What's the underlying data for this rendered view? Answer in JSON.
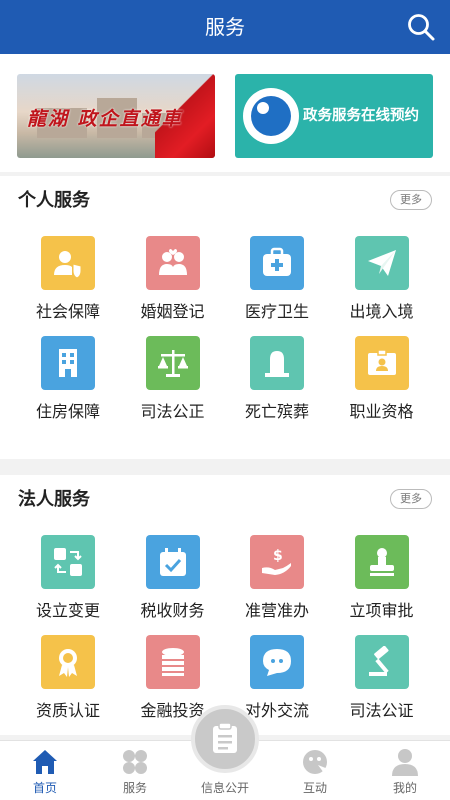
{
  "header": {
    "title": "服务"
  },
  "banners": {
    "left_text": "龍湖 政企直通車",
    "right_text": "政务服务在线预约"
  },
  "personal": {
    "title": "个人服务",
    "more": "更多",
    "items": [
      {
        "label": "社会保障",
        "icon": "user-shield-icon",
        "color": "#f5c24a"
      },
      {
        "label": "婚姻登记",
        "icon": "couple-icon",
        "color": "#e88989"
      },
      {
        "label": "医疗卫生",
        "icon": "medical-kit-icon",
        "color": "#4aa3df"
      },
      {
        "label": "出境入境",
        "icon": "paper-plane-icon",
        "color": "#5fc5b0"
      },
      {
        "label": "住房保障",
        "icon": "building-icon",
        "color": "#4aa3df"
      },
      {
        "label": "司法公正",
        "icon": "scales-icon",
        "color": "#6cbb5a"
      },
      {
        "label": "死亡殡葬",
        "icon": "tombstone-icon",
        "color": "#5fc5b0"
      },
      {
        "label": "职业资格",
        "icon": "id-card-icon",
        "color": "#f5c24a"
      }
    ]
  },
  "corporate": {
    "title": "法人服务",
    "more": "更多",
    "items": [
      {
        "label": "设立变更",
        "icon": "swap-icon",
        "color": "#5fc5b0"
      },
      {
        "label": "税收财务",
        "icon": "calendar-check-icon",
        "color": "#4aa3df"
      },
      {
        "label": "准营准办",
        "icon": "hand-money-icon",
        "color": "#e88989"
      },
      {
        "label": "立项审批",
        "icon": "stamp-icon",
        "color": "#6cbb5a"
      },
      {
        "label": "资质认证",
        "icon": "award-icon",
        "color": "#f5c24a"
      },
      {
        "label": "金融投资",
        "icon": "coins-icon",
        "color": "#e88989"
      },
      {
        "label": "对外交流",
        "icon": "chat-bubble-icon",
        "color": "#4aa3df"
      },
      {
        "label": "司法公证",
        "icon": "gavel-icon",
        "color": "#5fc5b0"
      }
    ]
  },
  "tabbar": {
    "tabs": [
      {
        "label": "首页",
        "icon": "home-icon",
        "active": true
      },
      {
        "label": "服务",
        "icon": "grid-icon",
        "active": false
      },
      {
        "label": "信息公开",
        "icon": "document-icon",
        "active": false
      },
      {
        "label": "互动",
        "icon": "chat-face-icon",
        "active": false
      },
      {
        "label": "我的",
        "icon": "person-icon",
        "active": false
      }
    ]
  }
}
